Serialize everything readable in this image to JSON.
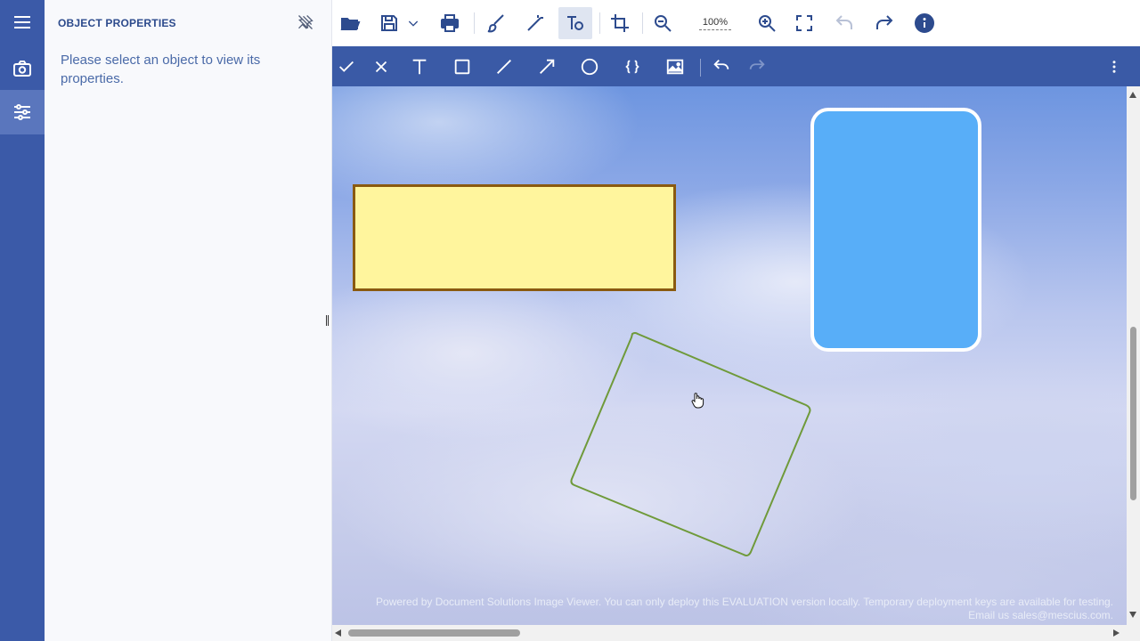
{
  "panel": {
    "title": "OBJECT PROPERTIES",
    "message": "Please select an object to view its properties."
  },
  "toolbar": {
    "zoom_level": "100%"
  },
  "rail": {
    "icons": [
      "menu-icon",
      "camera-icon",
      "sliders-icon"
    ]
  },
  "toolbar_icons": [
    "pin-off-icon",
    "open-folder-icon",
    "save-icon",
    "chevron-down-icon",
    "print-icon",
    "brush-icon",
    "magic-wand-icon",
    "text-object-icon",
    "crop-icon",
    "zoom-out-icon",
    "zoom-in-icon",
    "fullscreen-icon",
    "undo-icon",
    "redo-icon",
    "info-icon"
  ],
  "toolbar2_icons": [
    "apply-icon",
    "cancel-icon",
    "text-icon",
    "rectangle-icon",
    "line-icon",
    "arrow-icon",
    "ellipse-icon",
    "braces-icon",
    "image-icon",
    "undo-icon",
    "redo-icon",
    "more-vertical-icon"
  ],
  "colors": {
    "rail": "#3b5aa8",
    "secondary_toolbar": "#3a5aa6",
    "yellow_rect_fill": "#fff59d",
    "yellow_rect_border": "#8a5a10",
    "blue_rect_fill": "#58aef8",
    "green_outline": "#6f9a3a"
  },
  "canvas": {
    "watermark_line1": "Powered by Document Solutions Image Viewer. You can only deploy this EVALUATION version locally. Temporary deployment keys are available for testing.",
    "watermark_line2": "Email us sales@mescius.com."
  }
}
